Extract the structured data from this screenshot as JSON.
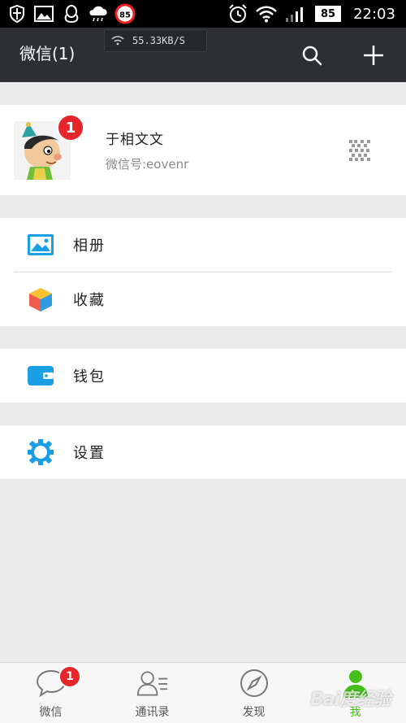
{
  "status_bar": {
    "battery_left": "85",
    "battery_right": "85",
    "time": "22:03",
    "network_speed": "55.33KB/S"
  },
  "header": {
    "title": "微信(1)",
    "search_icon": "search-icon",
    "add_icon": "plus-icon"
  },
  "profile": {
    "name": "于相文文",
    "wechat_id": "微信号:eovenr",
    "badge_count": "1"
  },
  "menu": {
    "album": "相册",
    "favorites": "收藏",
    "wallet": "钱包",
    "settings": "设置"
  },
  "bottom_nav": {
    "tabs": [
      {
        "label": "微信",
        "icon": "chat-bubble-icon",
        "badge": "1"
      },
      {
        "label": "通讯录",
        "icon": "contacts-icon"
      },
      {
        "label": "发现",
        "icon": "compass-icon"
      },
      {
        "label": "我",
        "icon": "person-icon",
        "active": true
      }
    ]
  },
  "colors": {
    "titlebar": "#2d2f33",
    "accent_green": "#45c01a",
    "badge_red": "#e5262b",
    "icon_blue": "#1a9ee5"
  },
  "watermark": "Bai度经验"
}
